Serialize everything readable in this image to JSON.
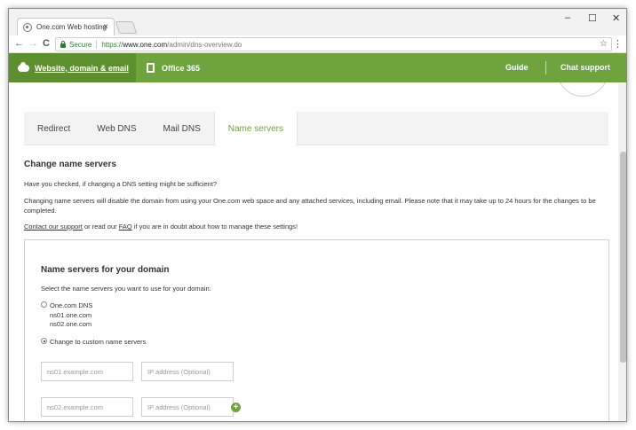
{
  "browser": {
    "tab_title": "One.com Web hosting",
    "tab_close": "×",
    "window_controls": {
      "minimize": "–",
      "maximize": "☐",
      "close": "✕"
    },
    "nav": {
      "back": "←",
      "forward": "→",
      "reload": "C"
    },
    "secure_label": "Secure",
    "url_protocol": "https://",
    "url_host": "www.one.com",
    "url_path": "/admin/dns-overview.do",
    "bookmark_icon": "☆",
    "menu_icon": "⋮"
  },
  "site_header": {
    "primary_link": "Website, domain & email",
    "office_link": "Office 365",
    "guide": "Guide",
    "chat_support": "Chat support",
    "accent": "#6fa33e",
    "accent_dark": "#5d8f31"
  },
  "dns_tabs": [
    {
      "label": "Redirect"
    },
    {
      "label": "Web DNS"
    },
    {
      "label": "Mail DNS"
    },
    {
      "label": "Name servers",
      "active": true
    }
  ],
  "section": {
    "heading": "Change name servers",
    "check_text": "Have you checked, if changing a DNS setting might be sufficient?",
    "warning_text": "Changing name servers will disable the domain from using your One.com web space and any attached services, including email. Please note that it may take up to 24 hours for the changes to be completed.",
    "support_link": "Contact our support",
    "support_mid": " or read our ",
    "faq_link": "FAQ",
    "support_end": " if you are in doubt about how to manage these settings!"
  },
  "panel": {
    "heading": "Name servers for your domain",
    "instruction": "Select the name servers you want to use for your domain:",
    "option_default": {
      "label": "One.com DNS",
      "servers": [
        "ns01.one.com",
        "ns02.one.com"
      ],
      "selected": false
    },
    "option_custom": {
      "label": "Change to custom name servers",
      "selected": true
    },
    "rows": [
      {
        "ns_placeholder": "ns01.example.com",
        "ip_placeholder": "IP address (Optional)"
      },
      {
        "ns_placeholder": "ns02.example.com",
        "ip_placeholder": "IP address (Optional)"
      }
    ],
    "add_button": "+"
  }
}
